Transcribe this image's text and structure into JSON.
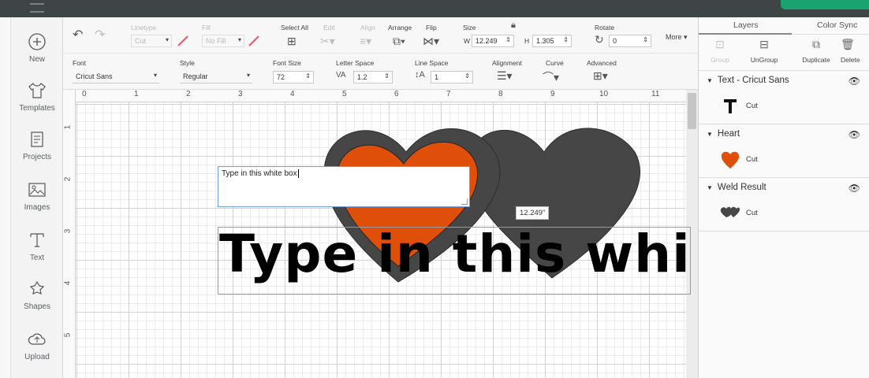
{
  "toolbar": {
    "linetype_label": "Linetype",
    "linetype_value": "Cut",
    "fill_label": "Fill",
    "fill_value": "No Fill",
    "select_all_label": "Select All",
    "edit_label": "Edit",
    "align_label": "Align",
    "arrange_label": "Arrange",
    "flip_label": "Flip",
    "size_label": "Size",
    "w_label": "W",
    "w_value": "12.249",
    "h_label": "H",
    "h_value": "1.305",
    "rotate_label": "Rotate",
    "rotate_value": "0",
    "more_label": "More"
  },
  "text_toolbar": {
    "font_label": "Font",
    "font_value": "Cricut Sans",
    "style_label": "Style",
    "style_value": "Regular",
    "font_size_label": "Font Size",
    "font_size_value": "72",
    "letter_space_label": "Letter Space",
    "letter_space_value": "1.2",
    "line_space_label": "Line Space",
    "line_space_value": "1",
    "alignment_label": "Alignment",
    "curve_label": "Curve",
    "advanced_label": "Advanced"
  },
  "left_tools": [
    {
      "label": "New",
      "icon": "plus-circle-icon"
    },
    {
      "label": "Templates",
      "icon": "shirt-icon"
    },
    {
      "label": "Projects",
      "icon": "projects-icon"
    },
    {
      "label": "Images",
      "icon": "image-icon"
    },
    {
      "label": "Text",
      "icon": "text-icon"
    },
    {
      "label": "Shapes",
      "icon": "shapes-icon"
    },
    {
      "label": "Upload",
      "icon": "upload-cloud-icon"
    }
  ],
  "ruler": {
    "top": [
      "0",
      "1",
      "2",
      "3",
      "4",
      "5",
      "6",
      "7",
      "8",
      "9",
      "10",
      "11"
    ],
    "left": [
      "1",
      "2",
      "3",
      "4",
      "5"
    ]
  },
  "canvas": {
    "textbox_value": "Type in this white box",
    "big_text": "Type in this white box",
    "dimension_tag": "12.249\""
  },
  "layers": {
    "tabs": [
      "Layers",
      "Color Sync"
    ],
    "actions": [
      "Group",
      "UnGroup",
      "Duplicate",
      "Delete"
    ],
    "groups": [
      {
        "title": "Text - Cricut Sans",
        "item": "Cut"
      },
      {
        "title": "Heart",
        "item": "Cut"
      },
      {
        "title": "Weld Result",
        "item": "Cut"
      }
    ]
  },
  "colors": {
    "orange": "#e04f0a",
    "dark_heart": "#464646"
  }
}
